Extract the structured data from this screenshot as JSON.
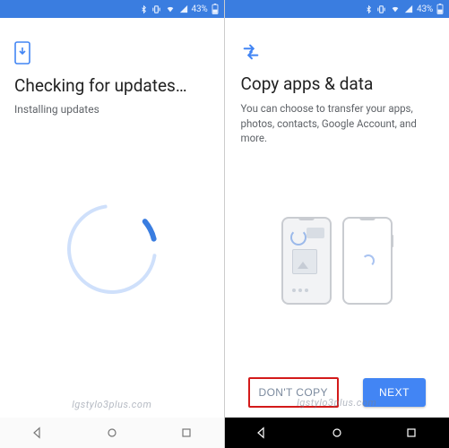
{
  "status_bar": {
    "battery_pct": "43%",
    "icons": [
      "bluetooth-icon",
      "vibrate-icon",
      "wifi-icon",
      "signal-icon",
      "battery-icon"
    ]
  },
  "left_screen": {
    "title": "Checking for updates…",
    "subtitle": "Installing updates"
  },
  "right_screen": {
    "title": "Copy apps & data",
    "description": "You can choose to transfer your apps, photos, contacts, Google Account, and more.",
    "dont_copy_label": "DON'T COPY",
    "next_label": "NEXT"
  },
  "watermark": "lgstylo3plus.com",
  "colors": {
    "primary": "#4285f4",
    "statusbar": "#3a7de0",
    "highlight_border": "#d31a1a"
  }
}
